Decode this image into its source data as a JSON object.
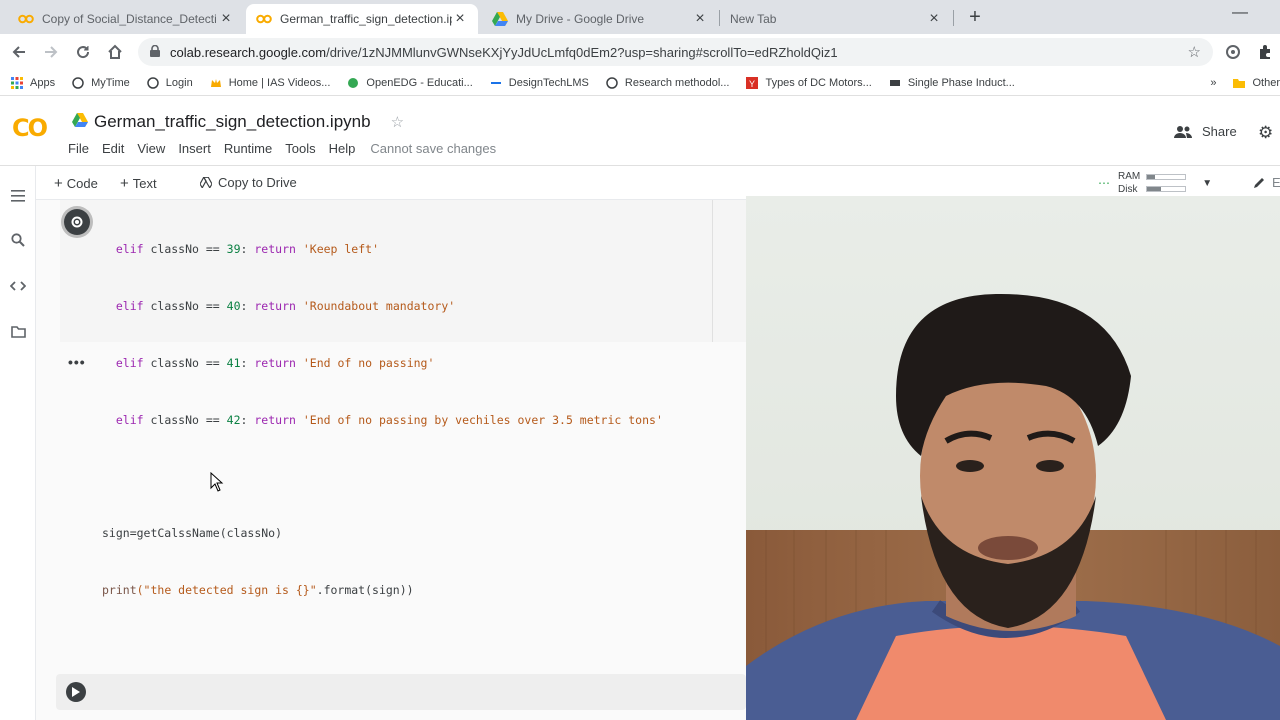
{
  "browser": {
    "tabs": [
      {
        "title": "Copy of Social_Distance_Detecti",
        "active": false,
        "icon": "colab-icon"
      },
      {
        "title": "German_traffic_sign_detection.ip",
        "active": true,
        "icon": "colab-icon"
      },
      {
        "title": "My Drive - Google Drive",
        "active": false,
        "icon": "google-drive-icon"
      },
      {
        "title": "New Tab",
        "active": false,
        "icon": "none"
      }
    ],
    "url_host": "colab.research.google.com",
    "url_path": "/drive/1zNJMMlunvGWNseKXjYyJdUcLmfq0dEm2?usp=sharing#scrollTo=edRZholdQiz1",
    "bookmarks": [
      "Apps",
      "MyTime",
      "Login",
      "Home | IAS Videos...",
      "OpenEDG - Educati...",
      "DesignTechLMS",
      "Research methodol...",
      "Types of DC Motors...",
      "Single Phase Induct..."
    ],
    "bookmarks_overflow": "»",
    "other_bookmarks": "Other"
  },
  "colab": {
    "logo": "CO",
    "notebook_title": "German_traffic_sign_detection.ipynb",
    "menu": [
      "File",
      "Edit",
      "View",
      "Insert",
      "Runtime",
      "Tools",
      "Help"
    ],
    "save_status": "Cannot save changes",
    "share_label": "Share",
    "toolbar": {
      "code_label": "Code",
      "text_label": "Text",
      "copy_to_drive_label": "Copy to Drive",
      "ram_label": "RAM",
      "disk_label": "Disk",
      "ram_usage": 0.2,
      "disk_usage": 0.35,
      "editing_label": "Editing"
    }
  },
  "cell": {
    "lines": [
      {
        "indent": "  ",
        "kw": "elif",
        "var": " classNo == ",
        "num": "39",
        "mid": ": ",
        "ret": "return",
        "str": " 'Keep left'"
      },
      {
        "indent": "  ",
        "kw": "elif",
        "var": " classNo == ",
        "num": "40",
        "mid": ": ",
        "ret": "return",
        "str": " 'Roundabout mandatory'"
      },
      {
        "indent": "  ",
        "kw": "elif",
        "var": " classNo == ",
        "num": "41",
        "mid": ": ",
        "ret": "return",
        "str": " 'End of no passing'"
      },
      {
        "indent": "  ",
        "kw": "elif",
        "var": " classNo == ",
        "num": "42",
        "mid": ": ",
        "ret": "return",
        "str": " 'End of no passing by vechiles over 3.5 metric tons'"
      }
    ],
    "line_assign": "sign=getCalssName(classNo)",
    "line_print_fn": "print",
    "line_print_str": "(\"the detected sign is {}\"",
    "line_print_rest": ".format(sign))",
    "output": "•••"
  },
  "colors": {
    "colab_orange": "#f9ab00",
    "keyword": "#9c27b0",
    "number": "#0b8043",
    "string": "#b55a1b"
  }
}
